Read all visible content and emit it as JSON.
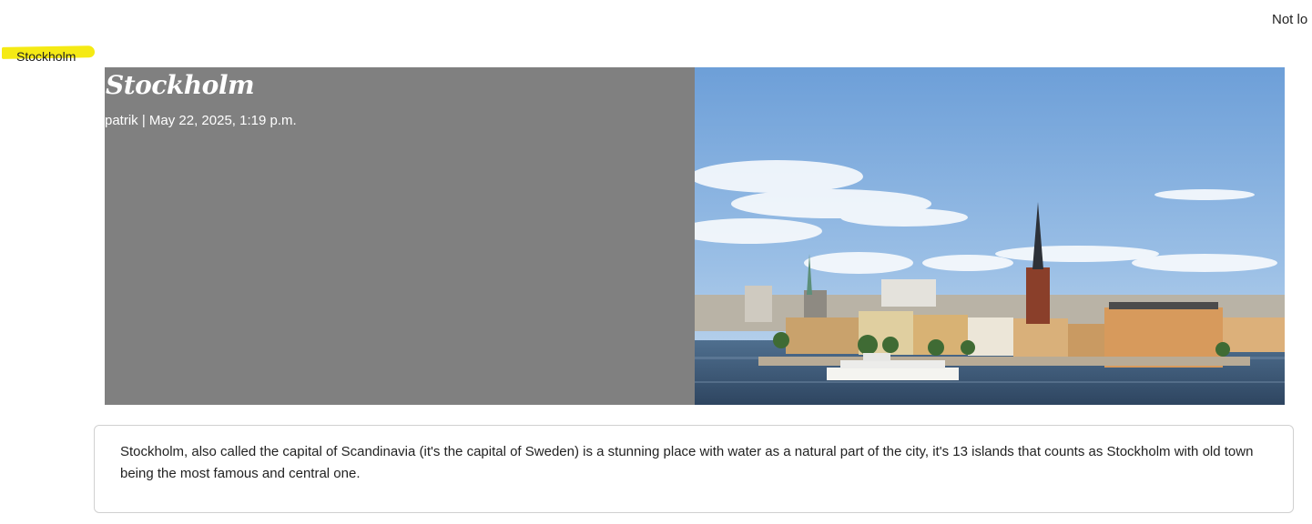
{
  "header": {
    "status_text": "Not lo"
  },
  "breadcrumb": {
    "label": "Stockholm",
    "highlight_color": "#f5ea14"
  },
  "post": {
    "title": "Stockholm",
    "meta": "patrik | May 22, 2025, 1:19 p.m.",
    "image_alt": "Stockholm skyline with Riddarholmen church",
    "body": "Stockholm, also called the capital of Scandinavia (it's the capital of Sweden) is a stunning place with water as a natural part of the city, it's 13 islands that counts as Stockholm with old town being the most famous and central one."
  },
  "colors": {
    "hero_panel": "#808080",
    "sky": "#7aa8dc",
    "water": "#3d5a78"
  }
}
